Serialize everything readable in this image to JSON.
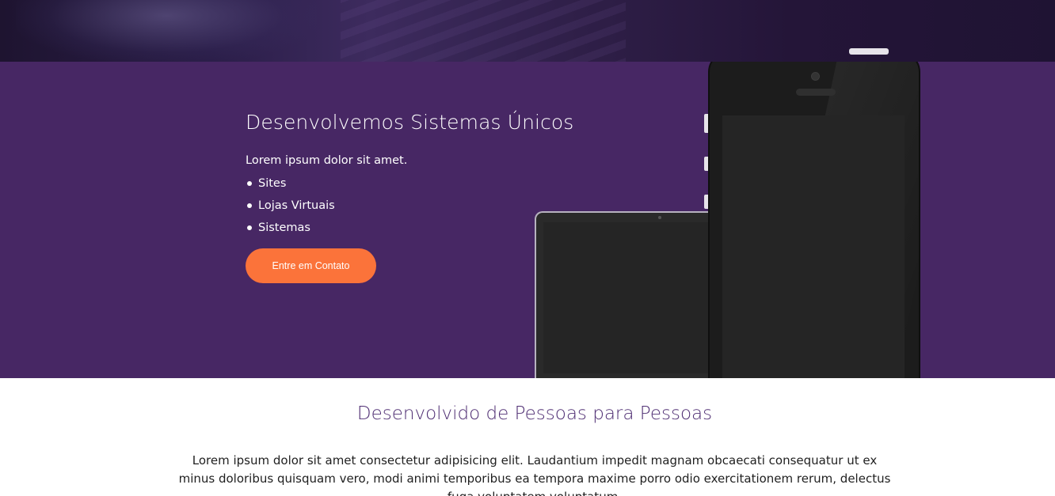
{
  "hero": {
    "title": "Desenvolvemos Sistemas Únicos",
    "intro": "Lorem ipsum dolor sit amet.",
    "services": [
      "Sites",
      "Lojas Virtuais",
      "Sistemas"
    ],
    "cta_label": "Entre em Contato"
  },
  "about": {
    "title": "Desenvolvido de Pessoas para Pessoas",
    "text": "Lorem ipsum dolor sit amet consectetur adipisicing elit. Laudantium impedit magnam obcaecati consequatur ut ex minus doloribus quisquam vero, modi animi temporibus ea tempora maxime porro odio exercitationem rerum, delectus fuga voluptatem voluptatum."
  },
  "colors": {
    "hero_background": "#472764",
    "cta_background": "#fb733a",
    "section_title": "#4f2e73"
  },
  "icons": [
    "tablet-device-image",
    "phone-device-image"
  ]
}
